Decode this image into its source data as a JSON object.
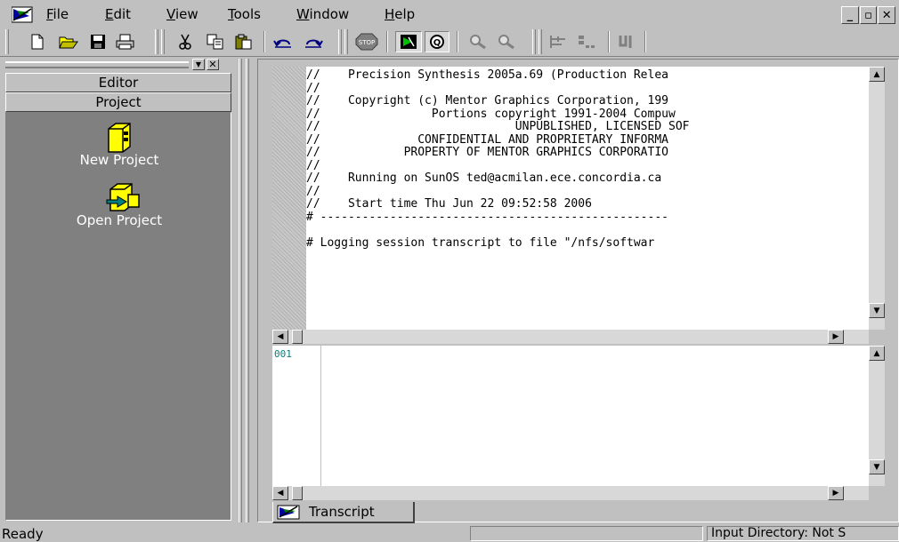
{
  "menu": {
    "items": [
      {
        "key": "F",
        "rest": "ile"
      },
      {
        "key": "E",
        "rest": "dit"
      },
      {
        "key": "V",
        "rest": "iew"
      },
      {
        "key": "T",
        "rest": "ools"
      },
      {
        "key": "W",
        "rest": "indow"
      },
      {
        "key": "H",
        "rest": "elp"
      }
    ]
  },
  "left_panel": {
    "tabs": [
      "Editor",
      "Project"
    ],
    "items": [
      {
        "label": "New Project",
        "icon": "new-project-icon"
      },
      {
        "label": "Open Project",
        "icon": "open-project-icon"
      }
    ]
  },
  "transcript": {
    "lines": [
      "//    Precision Synthesis 2005a.69 (Production Relea",
      "//",
      "//    Copyright (c) Mentor Graphics Corporation, 199",
      "//                Portions copyright 1991-2004 Compuw",
      "//                            UNPUBLISHED, LICENSED SOF",
      "//              CONFIDENTIAL AND PROPRIETARY INFORMA",
      "//            PROPERTY OF MENTOR GRAPHICS CORPORATIO",
      "//",
      "//    Running on SunOS ted@acmilan.ece.concordia.ca",
      "//",
      "//    Start time Thu Jun 22 09:52:58 2006",
      "# --------------------------------------------------",
      "",
      "# Logging session transcript to file \"/nfs/softwar"
    ],
    "command_line_number": "001",
    "tab_label": "Transcript"
  },
  "status": {
    "left": "Ready",
    "middle": "",
    "right": "Input Directory: Not S"
  }
}
